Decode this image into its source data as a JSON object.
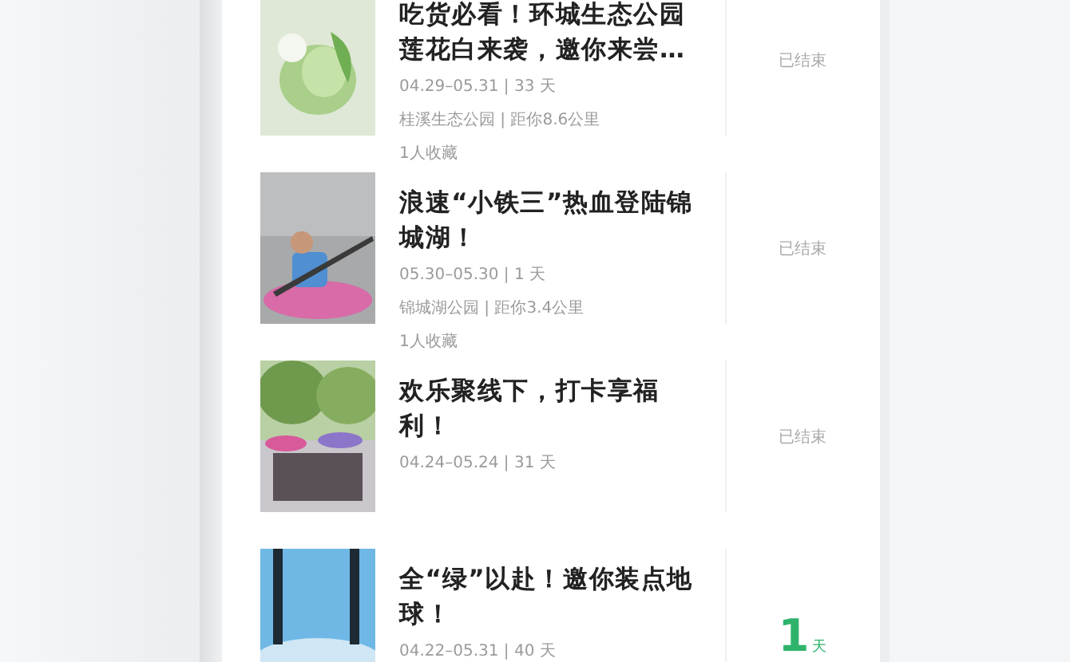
{
  "events": [
    {
      "title": "吃货必看！环城生态公园莲花白来袭，邀你来尝…",
      "dates": "04.29–05.31 | 33 天",
      "location": "桂溪生态公园 | 距你8.6公里",
      "favorites": "1人收藏",
      "status": {
        "kind": "ended",
        "text": "已结束"
      }
    },
    {
      "title": "浪速“小铁三”热血登陆锦城湖！",
      "dates": "05.30–05.30 | 1 天",
      "location": "锦城湖公园 | 距你3.4公里",
      "favorites": "1人收藏",
      "status": {
        "kind": "ended",
        "text": "已结束"
      }
    },
    {
      "title": "欢乐聚线下，打卡享福利！",
      "dates": "04.24–05.24 | 31 天",
      "status": {
        "kind": "ended",
        "text": "已结束"
      }
    },
    {
      "title": "全“绿”以赴！邀你装点地球！",
      "dates": "04.22–05.31 | 40 天",
      "status": {
        "kind": "countdown",
        "number": "1",
        "unit": "天"
      }
    }
  ]
}
